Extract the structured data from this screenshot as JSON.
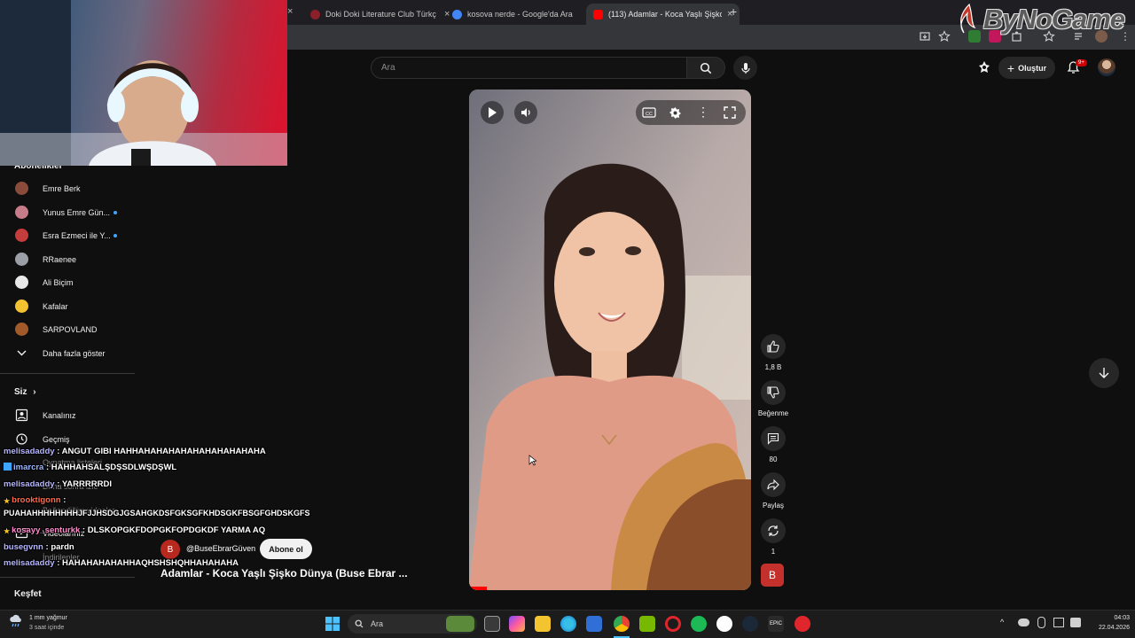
{
  "browser": {
    "tabs": [
      {
        "title": "Doki Doki Literature Club Türkç",
        "favicon_color": "#8b1f2a",
        "active": false
      },
      {
        "title": "kosova nerde - Google'da Ara",
        "favicon_color": "#4285f4",
        "active": false
      },
      {
        "title": "(113) Adamlar - Koca Yaşlı Şişko",
        "favicon_color": "#ff0000",
        "active": true
      }
    ],
    "new_tab": "+",
    "close": "×",
    "watermark": "ByNoGame"
  },
  "youtube": {
    "search_placeholder": "Ara",
    "create_label": "Oluştur",
    "notification_count": "9+"
  },
  "sidebar": {
    "subscriptions_heading": "Abonelikler",
    "channels": [
      {
        "name": "Emre Berk",
        "color": "#8b4b3a",
        "live": false
      },
      {
        "name": "Yunus Emre Gün...",
        "color": "#c77c8a",
        "live": true
      },
      {
        "name": "Esra Ezmeci ile Y...",
        "color": "#c43c3c",
        "live": true
      },
      {
        "name": "RRaenee",
        "color": "#9aa0a6",
        "live": false
      },
      {
        "name": "Ali Biçim",
        "color": "#e9e9e9",
        "live": false
      },
      {
        "name": "Kafalar",
        "color": "#f2c230",
        "live": false
      },
      {
        "name": "SARPOVLAND",
        "color": "#a35a2a",
        "live": false
      }
    ],
    "show_more": "Daha fazla göster",
    "you_heading": "Siz",
    "you_items": [
      "Kanalınız",
      "Geçmiş",
      "Oynatma listeleri",
      "Daha sonra izle",
      "Beğendiğim videolar",
      "Videolarınız",
      "İndirilenler"
    ],
    "explore_heading": "Keşfet"
  },
  "actions": {
    "likes": "1,8 B",
    "dislike_label": "Beğenme",
    "comments": "80",
    "share_label": "Paylaş",
    "remix_count": "1",
    "channel_initial": "B"
  },
  "video": {
    "channel_initial": "B",
    "channel_handle": "@BuseEbrarGüven",
    "subscribe_label": "Abone ol",
    "title": "Adamlar - Koca Yaşlı Şişko Dünya (Buse Ebrar ..."
  },
  "chat": [
    {
      "user": "melisadaddy",
      "sep": " : ",
      "text": "ANGUT GIBI HAHHAHAHAHAHAHAHAHAHAHAHA",
      "style": "u"
    },
    {
      "user": "imarcra",
      "sep": " : ",
      "text": "HAHHAHSALŞDŞSDLWŞDŞWL",
      "style": "u blue"
    },
    {
      "user": "melisadaddy",
      "sep": " : ",
      "text": "YARRRRRDI",
      "style": "u"
    },
    {
      "user": "brooktigonn",
      "sep": " :",
      "text": "",
      "style": "u red"
    },
    {
      "user": "",
      "sep": "",
      "text": "PUAHAHHHHHHHHJFJJHSDGJGSAHGKDSFGKSGFKHDSGKFBSGFGHDSKGFS",
      "style": "u"
    },
    {
      "user": "kosayy_senturkk",
      "sep": " : ",
      "text": "DLSKOPGKFDOPGKFOPDGKDF YARMA AQ",
      "style": "u pink"
    },
    {
      "user": "busegvnn",
      "sep": " : ",
      "text": "pardn",
      "style": "u"
    },
    {
      "user": "melisadaddy",
      "sep": " : ",
      "text": "HAHAHAHAHAHHAQHSHSHQHHAHAHAHA",
      "style": "u"
    }
  ],
  "taskbar": {
    "weather_temp": "1 mm yağmur",
    "weather_desc": "3 saat içinde",
    "search_label": "Ara",
    "time": "04:03",
    "date": "22.04.2026"
  }
}
